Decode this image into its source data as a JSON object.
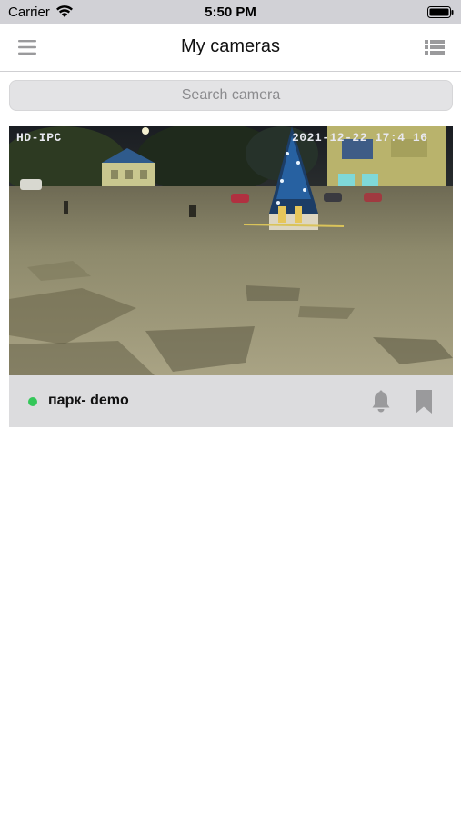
{
  "status_bar": {
    "carrier": "Carrier",
    "time": "5:50 PM",
    "icons": [
      "wifi-icon",
      "battery-icon"
    ]
  },
  "nav": {
    "title": "My cameras",
    "left_icon": "menu-icon",
    "right_icon": "list-view-icon"
  },
  "search": {
    "placeholder": "Search camera",
    "value": ""
  },
  "cameras": [
    {
      "name": "парк- demo",
      "status": "online",
      "status_color": "#34c759",
      "osd_left": "HD-IPC",
      "osd_right": "2021-12-22 17:4 16",
      "actions": [
        "bell-icon",
        "bookmark-icon"
      ]
    }
  ],
  "colors": {
    "status_bar_bg": "#d1d1d6",
    "card_footer_bg": "#dcdcde",
    "icon_gray": "#9a9a9c",
    "online": "#34c759"
  }
}
